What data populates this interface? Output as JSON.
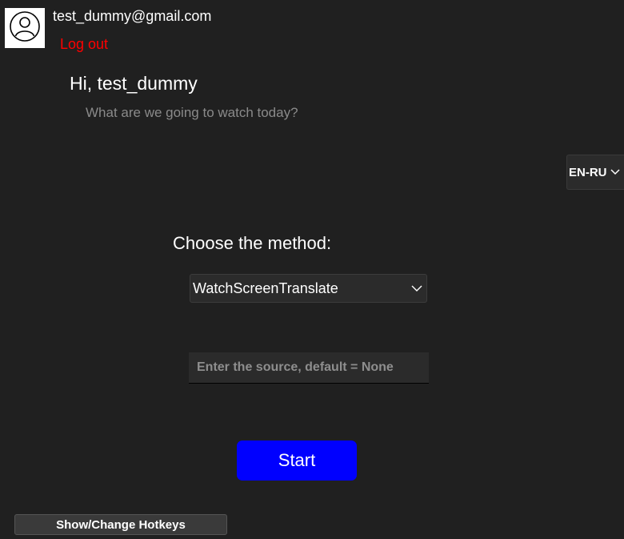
{
  "user": {
    "email": "test_dummy@gmail.com",
    "logout_label": "Log out",
    "avatar_icon": "user-circle-icon"
  },
  "greeting": {
    "title": "Hi, test_dummy",
    "subtitle": "What are we going to watch today?"
  },
  "language": {
    "selected": "EN-RU",
    "icon": "chevron-down-icon"
  },
  "method": {
    "title": "Choose the method:",
    "selected": "WatchScreenTranslate",
    "icon": "chevron-down-icon"
  },
  "source": {
    "value": "",
    "placeholder": "Enter the source, default = None"
  },
  "actions": {
    "start_label": "Start",
    "hotkeys_label": "Show/Change Hotkeys"
  },
  "colors": {
    "background": "#202020",
    "logout": "#ff0000",
    "start_button": "#0000ff",
    "muted_text": "#8a8a8a"
  }
}
